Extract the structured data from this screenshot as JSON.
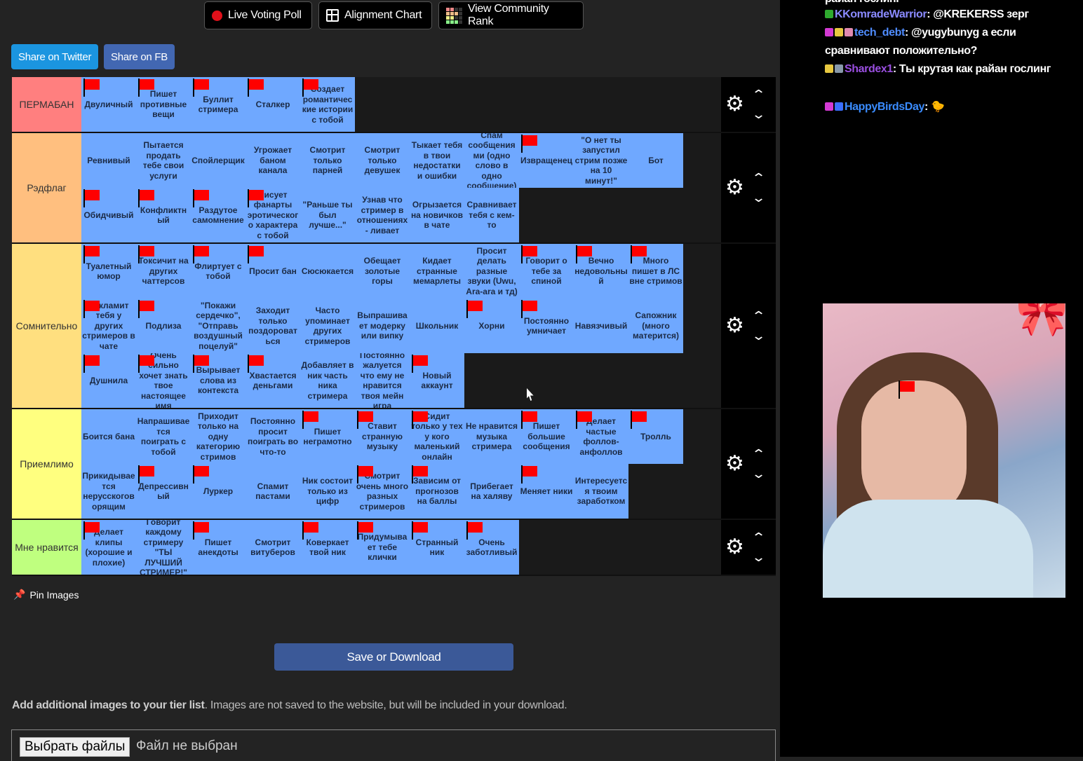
{
  "toolbar": {
    "live_poll": "Live Voting Poll",
    "alignment": "Alignment Chart",
    "community_rank": "View Community Rank",
    "share_twitter": "Share on Twitter",
    "share_fb": "Share on FB"
  },
  "tiers": [
    {
      "label": "ПЕРМАБАН",
      "color": "#ff7f7f",
      "items": [
        {
          "text": "Двуличный",
          "flag": true
        },
        {
          "text": "Пишет противные вещи",
          "flag": true
        },
        {
          "text": "Буллит стримера",
          "flag": true
        },
        {
          "text": "Сталкер",
          "flag": true
        },
        {
          "text": "Создает романтические истории с тобой",
          "flag": true
        }
      ]
    },
    {
      "label": "Рэдфлаг",
      "color": "#ffbf7f",
      "items": [
        {
          "text": "Ревнивый",
          "flag": false
        },
        {
          "text": "Пытается продать тебе свои услуги",
          "flag": false
        },
        {
          "text": "Спойлерщик",
          "flag": false
        },
        {
          "text": "Угрожает баном канала",
          "flag": false
        },
        {
          "text": "Смотрит только парней",
          "flag": false
        },
        {
          "text": "Смотрит только девушек",
          "flag": false
        },
        {
          "text": "Тыкает тебя в твои недостатки и ошибки",
          "flag": false
        },
        {
          "text": "Спам сообщениями (одно слово в одно сообщение)",
          "flag": false
        },
        {
          "text": "Извращенец",
          "flag": true
        },
        {
          "text": "\"О нет ты запустил стрим позже на 10 минут!\"",
          "flag": false
        },
        {
          "text": "Бот",
          "flag": false
        },
        {
          "text": "Обидчивый",
          "flag": true
        },
        {
          "text": "Конфликтный",
          "flag": true
        },
        {
          "text": "Раздутое самомнение",
          "flag": true
        },
        {
          "text": "Рисует фанарты эротического характера с тобой",
          "flag": true
        },
        {
          "text": "\"Раньше ты был лучше...\"",
          "flag": false
        },
        {
          "text": "Узнав что стример в отношениях - ливает",
          "flag": false
        },
        {
          "text": "Огрызается на новичков в чате",
          "flag": false
        },
        {
          "text": "Сравнивает тебя с кем-то",
          "flag": false
        }
      ]
    },
    {
      "label": "Сомнительно",
      "color": "#ffdf7f",
      "items": [
        {
          "text": "Туалетный юмор",
          "flag": true
        },
        {
          "text": "Токсичит на других чаттерсов",
          "flag": true
        },
        {
          "text": "Флиртует с тобой",
          "flag": true
        },
        {
          "text": "Просит бан",
          "flag": true
        },
        {
          "text": "Сюсюкается",
          "flag": false
        },
        {
          "text": "Обещает золотые горы",
          "flag": false
        },
        {
          "text": "Кидает странные мемарлеты",
          "flag": false
        },
        {
          "text": "Просит делать разные звуки (Uwu, Ara-ara и тд)",
          "flag": false
        },
        {
          "text": "Говорит о тебе за спиной",
          "flag": true
        },
        {
          "text": "Вечно недовольный",
          "flag": true
        },
        {
          "text": "Много пишет в ЛС вне стримов",
          "flag": true
        },
        {
          "text": "Рекламит тебя у других стримеров в чате",
          "flag": true
        },
        {
          "text": "Подлиза",
          "flag": true
        },
        {
          "text": "\"Покажи сердечко\", \"Отправь воздушный поцелуй\"",
          "flag": false
        },
        {
          "text": "Заходит только поздороваться",
          "flag": false
        },
        {
          "text": "Часто упоминает других стримеров",
          "flag": false
        },
        {
          "text": "Выпрашивает модерку или випку",
          "flag": false
        },
        {
          "text": "Школьник",
          "flag": false
        },
        {
          "text": "Хорни",
          "flag": true
        },
        {
          "text": "Постоянно умничает",
          "flag": true
        },
        {
          "text": "Навязчивый",
          "flag": false
        },
        {
          "text": "Сапожник (много матерится)",
          "flag": false
        },
        {
          "text": "Душнила",
          "flag": true
        },
        {
          "text": "Очень сильно хочет знать твое настоящее имя",
          "flag": true
        },
        {
          "text": "Вырывает слова из контекста",
          "flag": true
        },
        {
          "text": "Хвастается деньгами",
          "flag": true
        },
        {
          "text": "Добавляет в ник часть ника стримера",
          "flag": false
        },
        {
          "text": "Постоянно жалуется что ему не нравится твоя мейн игра",
          "flag": false
        },
        {
          "text": "Новый аккаунт",
          "flag": true
        }
      ]
    },
    {
      "label": "Приемлимо",
      "color": "#ffff7f",
      "items": [
        {
          "text": "Боится бана",
          "flag": false
        },
        {
          "text": "Напрашивается поиграть с тобой",
          "flag": false
        },
        {
          "text": "Приходит только на одну категорию стримов",
          "flag": false
        },
        {
          "text": "Постоянно просит поиграть во что-то",
          "flag": false
        },
        {
          "text": "Пишет неграмотно",
          "flag": true
        },
        {
          "text": "Ставит странную музыку",
          "flag": true
        },
        {
          "text": "Сидит только у тех у кого маленький онлайн",
          "flag": true
        },
        {
          "text": "Не нравится музыка стримера",
          "flag": false
        },
        {
          "text": "Пишет большие сообщения",
          "flag": true
        },
        {
          "text": "Делает частые фоллов-анфоллов",
          "flag": true
        },
        {
          "text": "Тролль",
          "flag": true
        },
        {
          "text": "Прикидывается нерусскоговорящим",
          "flag": false
        },
        {
          "text": "Депрессивный",
          "flag": true
        },
        {
          "text": "Луркер",
          "flag": true
        },
        {
          "text": "Спамит пастами",
          "flag": false
        },
        {
          "text": "Ник состоит только из цифр",
          "flag": false
        },
        {
          "text": "Смотрит очень много разных стримеров",
          "flag": true
        },
        {
          "text": "Зависим от прогнозов на баллы",
          "flag": true
        },
        {
          "text": "Прибегает на халяву",
          "flag": false
        },
        {
          "text": "Меняет ники",
          "flag": true
        },
        {
          "text": "Интересуется твоим заработком",
          "flag": false
        }
      ]
    },
    {
      "label": "Мне нравится",
      "color": "#bfff7f",
      "items": [
        {
          "text": "Делает клипы (хорошие и плохие)",
          "flag": true
        },
        {
          "text": "Говорит каждому стримеру \"ТЫ ЛУЧШИЙ СТРИМЕР!\"",
          "flag": false
        },
        {
          "text": "Пишет анекдоты",
          "flag": true
        },
        {
          "text": "Смотрит витуберов",
          "flag": false
        },
        {
          "text": "Коверкает твой ник",
          "flag": true
        },
        {
          "text": "Придумывает тебе клички",
          "flag": true
        },
        {
          "text": "Странный ник",
          "flag": true
        },
        {
          "text": "Очень заботливый",
          "flag": true
        }
      ]
    }
  ],
  "pin_images": "Pin Images",
  "save_download": "Save or Download",
  "add_images": {
    "bold": "Add additional images to your tier list",
    "rest": ". Images are not saved to the website, but will be included in your download."
  },
  "file_input": {
    "button": "Выбрать файлы",
    "status": "Файл не выбран"
  },
  "chat": [
    {
      "user": "",
      "text": "райан гослинг",
      "color": "#fff",
      "badges": []
    },
    {
      "user": "KKomradeWarrior",
      "text": "@KREKERSS зерг",
      "color": "#8a8aff",
      "badges": [
        "#2faa2f"
      ]
    },
    {
      "user": "tech_debt",
      "text": "@yugybunyg а если сравнивают положительно?",
      "color": "#4f8cff",
      "badges": [
        "#d43ad4",
        "#e8c840",
        "#e08ab0"
      ]
    },
    {
      "user": "Shardex1",
      "text": "Ты крутая как райан гослинг",
      "color": "#9a4fe0",
      "badges": [
        "#e8c840",
        "#8899aa"
      ]
    },
    {
      "user": "HappyBirdsDay",
      "text": "🐤",
      "color": "#3a8cff",
      "badges": [
        "#d43ad4",
        "#3a6fff"
      ]
    }
  ]
}
